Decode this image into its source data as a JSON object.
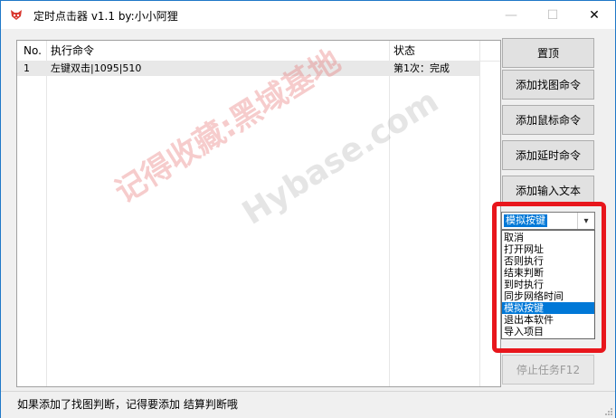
{
  "window": {
    "title": "定时点击器 v1.1 by:小小阿狸",
    "controls": {
      "minimize": "—",
      "maximize": "☐",
      "close": "✕"
    }
  },
  "table": {
    "headers": [
      "No.",
      "执行命令",
      "状态"
    ],
    "rows": [
      {
        "no": "1",
        "command": "左键双击|1095|510",
        "status": "第1次：完成"
      }
    ]
  },
  "buttons": {
    "pin_top": "置顶",
    "add_find_image": "添加找图命令",
    "add_mouse": "添加鼠标命令",
    "add_delay": "添加延时命令",
    "add_input_text": "添加输入文本",
    "stop_task": "停止任务F12"
  },
  "combo": {
    "selected": "模拟按键",
    "options": [
      "取消",
      "打开网址",
      "否则执行",
      "结束判断",
      "到时执行",
      "同步网络时间",
      "模拟按键",
      "退出本软件",
      "导入项目"
    ],
    "selected_index": 6
  },
  "watermarks": {
    "cn": "记得收藏:黑域基地",
    "en": "Hybase.com"
  },
  "status_text": "如果添加了找图判断，记得要添加 结算判断哦",
  "colors": {
    "highlight": "#0078d7",
    "annotation_red": "#e8161c",
    "window_border": "#1f78c8"
  }
}
